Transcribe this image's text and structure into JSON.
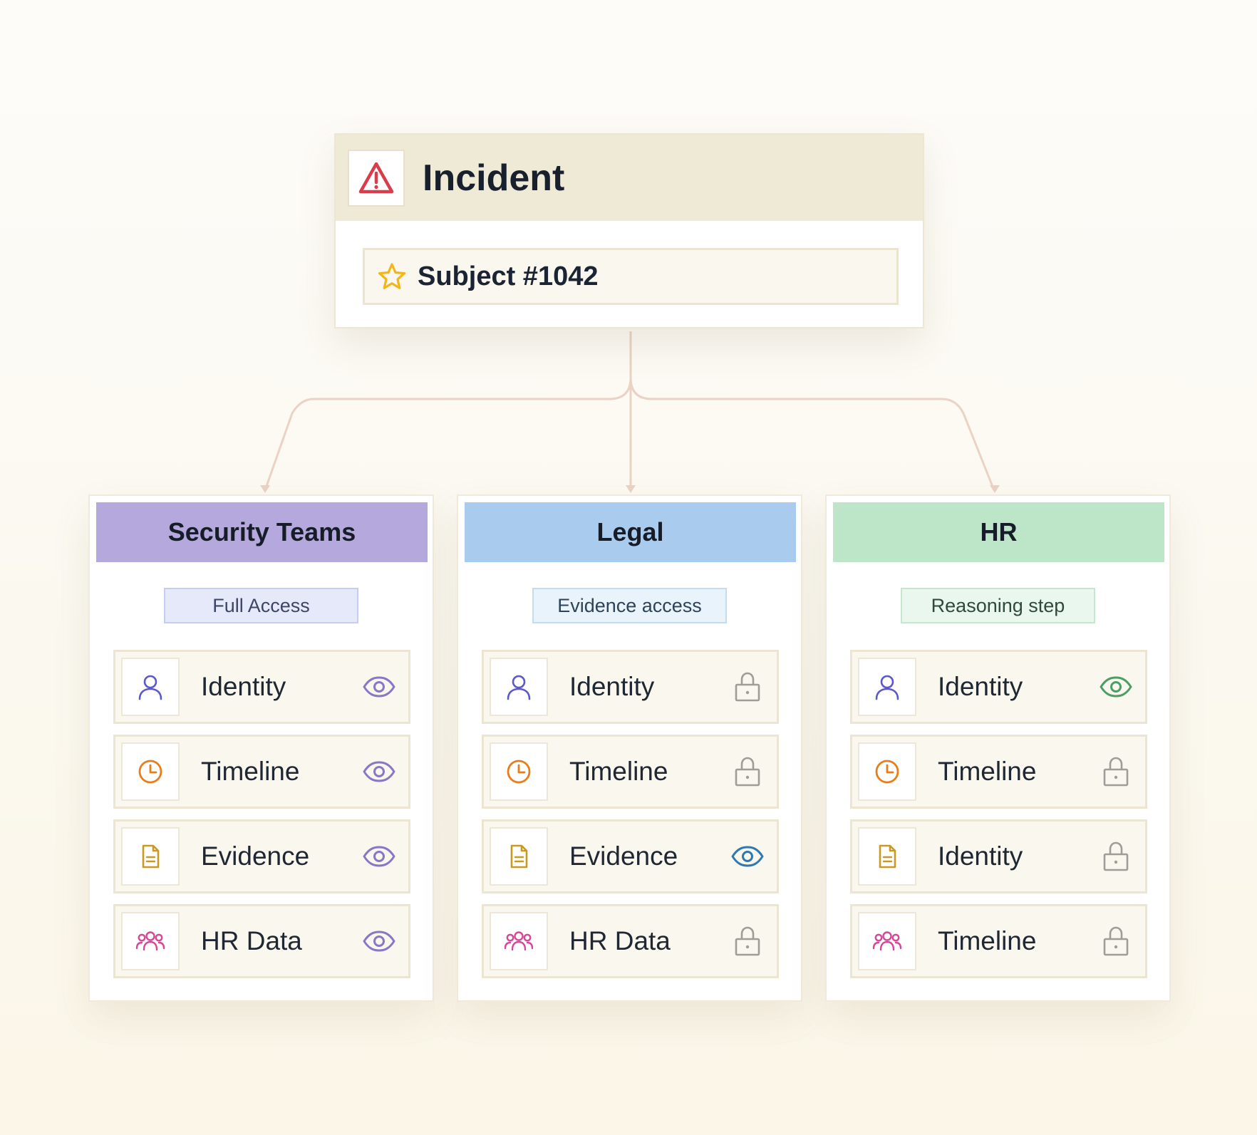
{
  "colors": {
    "connector": "#ead2c5",
    "incident_header": "#efead6",
    "warning_red": "#d93c4a",
    "star_yellow": "#f2b51a",
    "user_purple": "#5b58c9",
    "clock_orange": "#e87d1c",
    "doc_gold": "#c99a22",
    "people_pink": "#d6479a",
    "eye_purple": "#8a76c6",
    "eye_blue": "#2f78b0",
    "eye_green": "#4c9f63",
    "lock_gray": "#a09c98"
  },
  "incident": {
    "title": "Incident",
    "icon": "warning-icon",
    "subject": {
      "label": "Subject #1042",
      "icon": "star-icon"
    }
  },
  "roles": [
    {
      "key": "security",
      "title": "Security Teams",
      "header_color": "#b4a8dc",
      "badge": {
        "label": "Full Access",
        "bg": "#e6e9fa",
        "border": "#c6cdf0",
        "color": "#3c4664"
      },
      "rows": [
        {
          "label": "Identity",
          "icon": "user",
          "action": "eye-purple"
        },
        {
          "label": "Timeline",
          "icon": "clock",
          "action": "eye-purple"
        },
        {
          "label": "Evidence",
          "icon": "document",
          "action": "eye-purple"
        },
        {
          "label": "HR Data",
          "icon": "people",
          "action": "eye-purple"
        }
      ]
    },
    {
      "key": "legal",
      "title": "Legal",
      "header_color": "#a9cbee",
      "badge": {
        "label": "Evidence access",
        "bg": "#e9f3fb",
        "border": "#c5dcef",
        "color": "#2e4358"
      },
      "rows": [
        {
          "label": "Identity",
          "icon": "user",
          "action": "lock"
        },
        {
          "label": "Timeline",
          "icon": "clock",
          "action": "lock"
        },
        {
          "label": "Evidence",
          "icon": "document",
          "action": "eye-blue"
        },
        {
          "label": "HR Data",
          "icon": "people",
          "action": "lock"
        }
      ]
    },
    {
      "key": "hr",
      "title": "HR",
      "header_color": "#bde5c8",
      "badge": {
        "label": "Reasoning step",
        "bg": "#eaf7ee",
        "border": "#c6e6cf",
        "color": "#2f4a3a"
      },
      "rows": [
        {
          "label": "Identity",
          "icon": "user",
          "action": "eye-green"
        },
        {
          "label": "Timeline",
          "icon": "clock",
          "action": "lock"
        },
        {
          "label": "Identity",
          "icon": "document",
          "action": "lock"
        },
        {
          "label": "Timeline",
          "icon": "people",
          "action": "lock"
        }
      ]
    }
  ]
}
